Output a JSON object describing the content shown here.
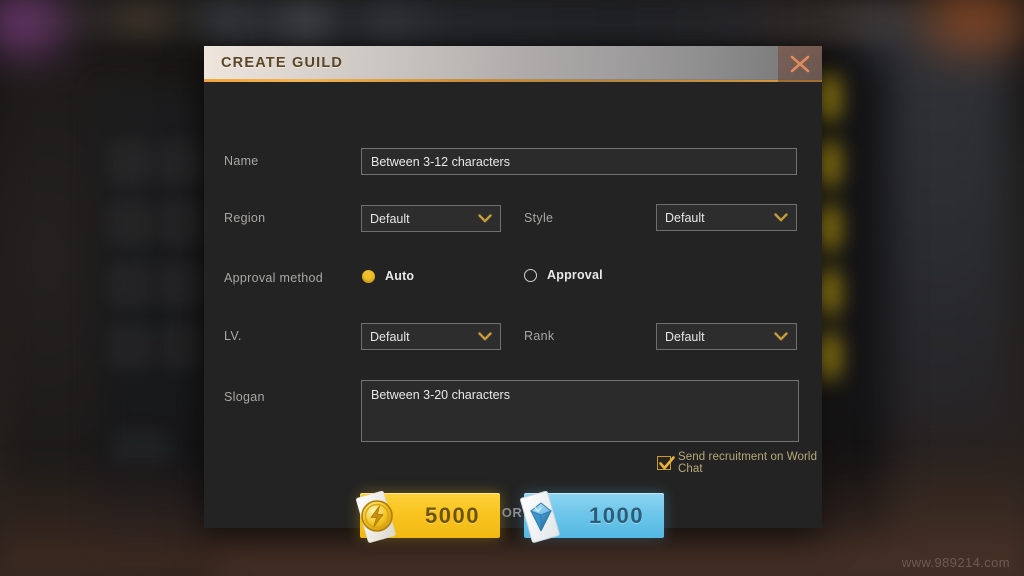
{
  "window": {
    "title": "CREATE GUILD",
    "close_icon": "close-x-icon"
  },
  "background": {
    "watermark": "www.989214.com"
  },
  "form": {
    "name": {
      "label": "Name",
      "placeholder": "Between 3-12 characters",
      "value": "Between 3-12 characters"
    },
    "region": {
      "label": "Region",
      "value": "Default",
      "chevron_icon": "chevron-down-icon"
    },
    "style": {
      "label": "Style",
      "value": "Default",
      "chevron_icon": "chevron-down-icon"
    },
    "approval_method": {
      "label": "Approval method",
      "options": [
        {
          "label": "Auto",
          "selected": true
        },
        {
          "label": "Approval",
          "selected": false
        }
      ]
    },
    "lv": {
      "label": "LV.",
      "value": "Default",
      "chevron_icon": "chevron-down-icon"
    },
    "rank": {
      "label": "Rank",
      "value": "Default",
      "chevron_icon": "chevron-down-icon"
    },
    "slogan": {
      "label": "Slogan",
      "placeholder": "Between 3-20 characters",
      "value": "Between 3-20 characters"
    },
    "world_chat": {
      "label": "Send recruitment on World Chat",
      "checked": true,
      "check_icon": "checkmark-icon"
    }
  },
  "actions": {
    "coin_button": {
      "amount": "5000",
      "icon": "gold-coin-icon"
    },
    "separator": "OR",
    "diamond_button": {
      "amount": "1000",
      "icon": "diamond-icon"
    }
  },
  "colors": {
    "accent_gold": "#f0c02a",
    "title_underline": "#e8a33a",
    "coin_button": "#fac521",
    "diamond_button": "#6ec6ea",
    "close_x": "#e08a5e",
    "panel_bg": "#232323"
  }
}
